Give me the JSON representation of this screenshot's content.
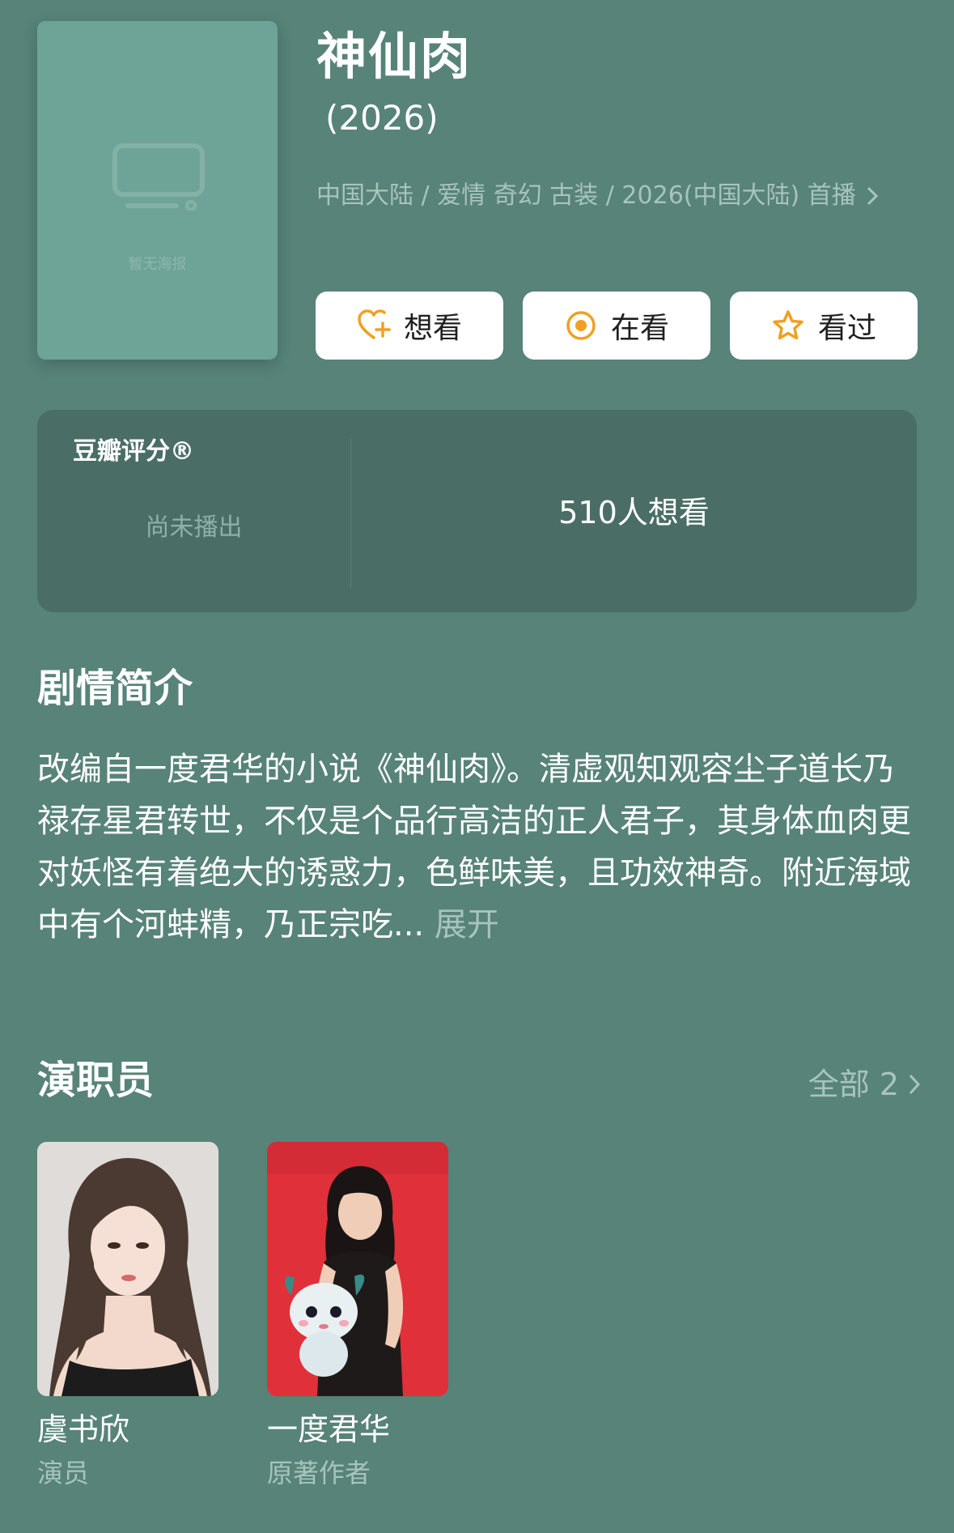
{
  "movie": {
    "poster_placeholder": "暂无海报",
    "title": "神仙肉",
    "year": "(2026)",
    "meta": "中国大陆 / 爱情 奇幻 古装 / 2026(中国大陆) 首播"
  },
  "actions": [
    {
      "label": "想看",
      "icon": "heart-plus-icon"
    },
    {
      "label": "在看",
      "icon": "record-icon"
    },
    {
      "label": "看过",
      "icon": "star-icon"
    }
  ],
  "rating": {
    "label": "豆瓣评分®",
    "status": "尚未播出",
    "want_count": "510人想看"
  },
  "synopsis": {
    "title": "剧情简介",
    "text": "改编自一度君华的小说《神仙肉》。清虚观知观容尘子道长乃禄存星君转世，不仅是个品行高洁的正人君子，其身体血肉更对妖怪有着绝大的诱惑力，色鲜味美，且功效神奇。附近海域中有个河蚌精，乃正宗吃...",
    "more": "展开"
  },
  "cast": {
    "title": "演职员",
    "all_label": "全部 2",
    "members": [
      {
        "name": "虞书欣",
        "role": "演员"
      },
      {
        "name": "一度君华",
        "role": "原著作者"
      }
    ]
  },
  "colors": {
    "background": "#578378",
    "accent": "#f0a020",
    "card": "#4a6e66"
  }
}
